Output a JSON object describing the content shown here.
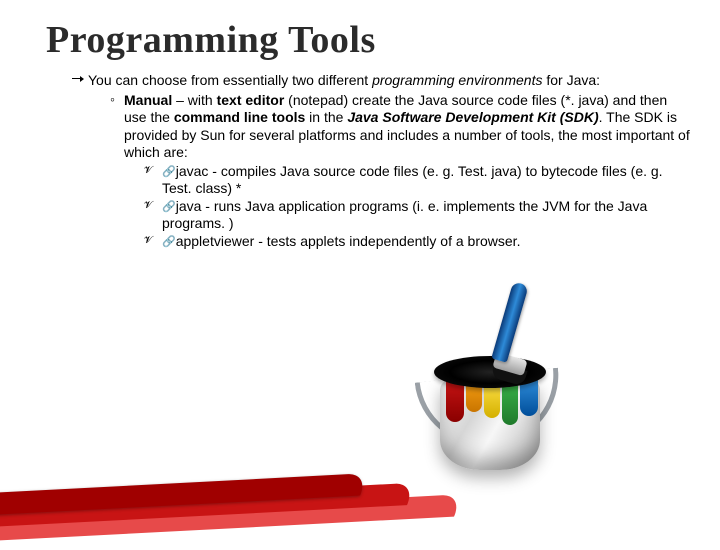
{
  "title": "Programming Tools",
  "intro_prefix": "You can choose from essentially two different ",
  "intro_em": "programming environments",
  "intro_suffix": " for Java:",
  "manual_label": "Manual",
  "manual_dash": " – with ",
  "manual_texteditor": "text editor",
  "manual_mid1": " (notepad) create the Java source code files (*. java) and then use the ",
  "manual_cmdline": "command line tools",
  "manual_mid2": " in the ",
  "manual_sdk": "Java Software Development Kit (SDK)",
  "manual_tail": ". The SDK is provided by Sun for several platforms and includes a number of tools, the most important of which are:",
  "tools": {
    "javac": "javac - compiles Java source code files (e. g. Test. java) to bytecode files (e. g. Test. class) *",
    "java": "java - runs Java application programs (i. e. implements the JVM for the Java programs. )",
    "appletviewer": "appletviewer - tests applets independently of a browser."
  }
}
